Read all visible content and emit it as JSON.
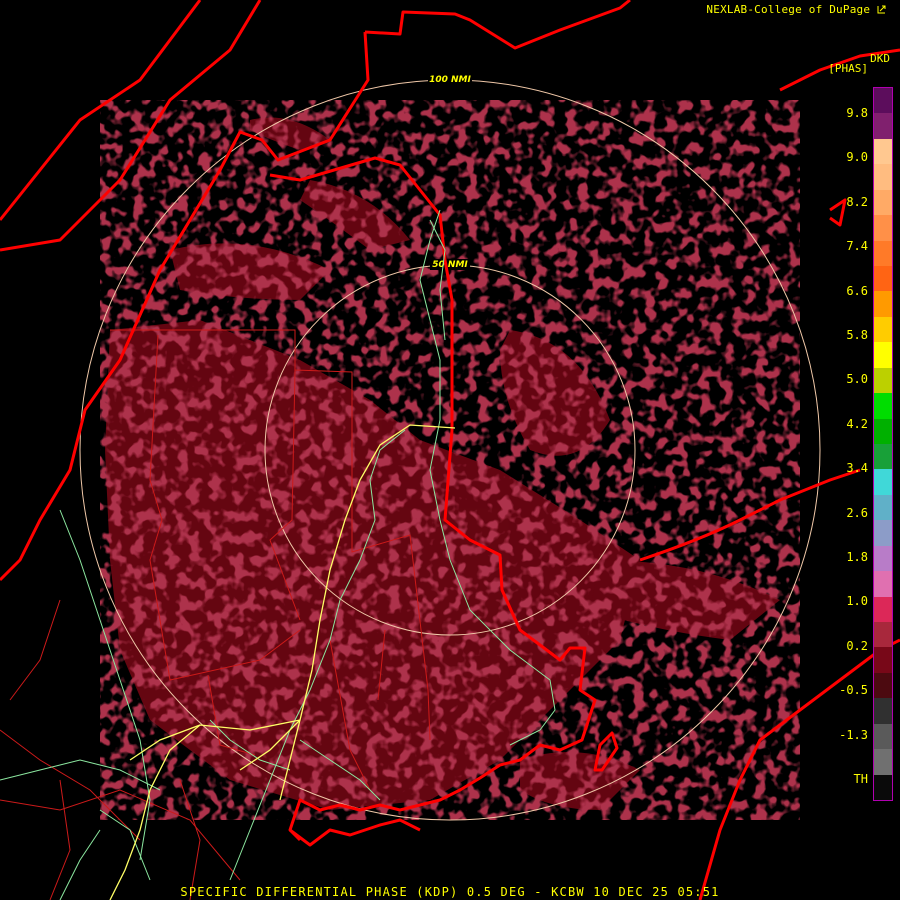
{
  "header": {
    "credit": "NEXLAB-College of DuPage",
    "credit_icon": "external-link-icon"
  },
  "legend": {
    "product": "DKD",
    "unit": "[PHAS]",
    "tick_labels": [
      "9.8",
      "9.0",
      "8.2",
      "7.4",
      "6.6",
      "5.8",
      "5.0",
      "4.2",
      "3.4",
      "2.6",
      "1.8",
      "1.0",
      "0.2",
      "-0.5",
      "-1.3",
      "TH"
    ],
    "color_steps": [
      "#5c0d5c",
      "#80206e",
      "#ffc890",
      "#ffbc80",
      "#ffaa66",
      "#ff9048",
      "#ff7a28",
      "#ff6414",
      "#ff9a00",
      "#ffcc00",
      "#ffff00",
      "#bcd000",
      "#00dd00",
      "#00b000",
      "#18a038",
      "#40d8d8",
      "#60b0c8",
      "#8c9cc8",
      "#b87cc8",
      "#e070b0",
      "#dc2858",
      "#a8283c",
      "#780818",
      "#4c0a10",
      "#303030",
      "#5a5a5a",
      "#707070",
      "#0a0a0a"
    ]
  },
  "map": {
    "range_rings": [
      {
        "label": "50 NMI",
        "radius_nmi": 50
      },
      {
        "label": "100 NMI",
        "radius_nmi": 100
      }
    ],
    "colors": {
      "coastline": "#ff0000",
      "boundaries": "#cc1a1a",
      "rivers": "#8ce8a0",
      "highways": "#ffff66",
      "range_rings": "#f0c8a8",
      "echo": "#6a0612"
    }
  },
  "footer": {
    "caption": "SPECIFIC DIFFERENTIAL PHASE (KDP) 0.5 DEG - KCBW 10 DEC 25 05:51"
  }
}
